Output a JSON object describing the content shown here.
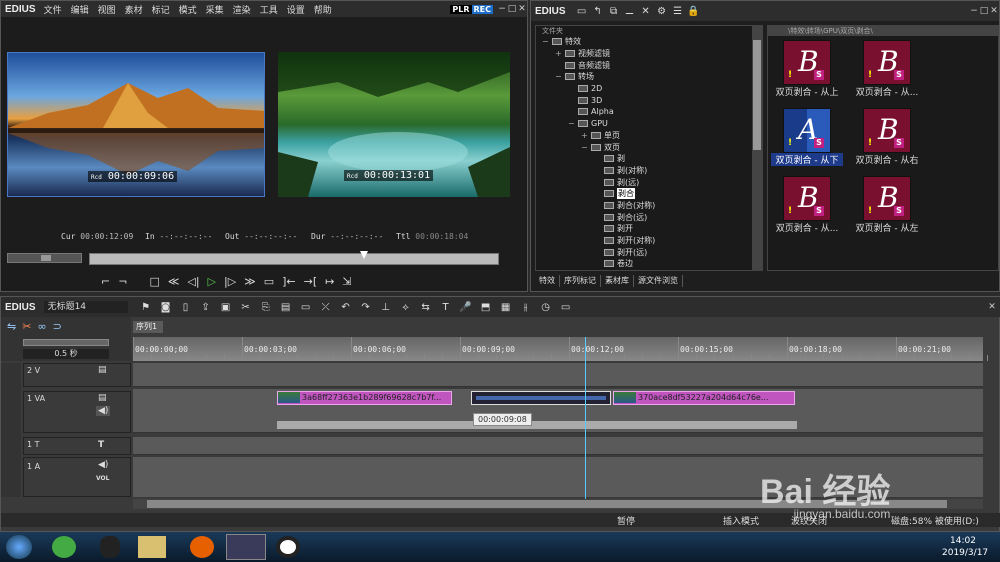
{
  "player": {
    "logo": "EDIUS",
    "menu": [
      "文件",
      "编辑",
      "视图",
      "素材",
      "标记",
      "模式",
      "采集",
      "渲染",
      "工具",
      "设置",
      "帮助"
    ],
    "plr": "PLR",
    "rec": "REC",
    "left_tc_label": "Rcd",
    "left_tc": "00:00:09:06",
    "right_tc_label": "Rcd",
    "right_tc": "00:00:13:01",
    "cur_label": "Cur",
    "cur_value": "00:00:12:09",
    "in_label": "In",
    "in_value": "--:--:--:--",
    "out_label": "Out",
    "out_value": "--:--:--:--",
    "dur_label": "Dur",
    "dur_value": "--:--:--:--",
    "ttl_label": "Ttl",
    "ttl_value": "00:00:18:04"
  },
  "library": {
    "logo": "EDIUS",
    "folder_header": "文件夹",
    "path": "\\特效\\转场\\GPU\\双页\\剥合\\",
    "tree": [
      {
        "label": "特效",
        "indent": 0,
        "exp": "−"
      },
      {
        "label": "视频滤镜",
        "indent": 1,
        "exp": "+"
      },
      {
        "label": "音频滤镜",
        "indent": 1,
        "exp": ""
      },
      {
        "label": "转场",
        "indent": 1,
        "exp": "−"
      },
      {
        "label": "2D",
        "indent": 2,
        "exp": ""
      },
      {
        "label": "3D",
        "indent": 2,
        "exp": ""
      },
      {
        "label": "Alpha",
        "indent": 2,
        "exp": ""
      },
      {
        "label": "GPU",
        "indent": 2,
        "exp": "−"
      },
      {
        "label": "单页",
        "indent": 3,
        "exp": "+"
      },
      {
        "label": "双页",
        "indent": 3,
        "exp": "−"
      },
      {
        "label": "剥",
        "indent": 4,
        "exp": ""
      },
      {
        "label": "剥(对称)",
        "indent": 4,
        "exp": ""
      },
      {
        "label": "剥(远)",
        "indent": 4,
        "exp": ""
      },
      {
        "label": "剥合",
        "indent": 4,
        "exp": "",
        "selected": true
      },
      {
        "label": "剥合(对称)",
        "indent": 4,
        "exp": ""
      },
      {
        "label": "剥合(远)",
        "indent": 4,
        "exp": ""
      },
      {
        "label": "剥开",
        "indent": 4,
        "exp": ""
      },
      {
        "label": "剥开(对称)",
        "indent": 4,
        "exp": ""
      },
      {
        "label": "剥开(远)",
        "indent": 4,
        "exp": ""
      },
      {
        "label": "卷边",
        "indent": 4,
        "exp": ""
      }
    ],
    "effects": [
      {
        "label": "双页剥合 - 从上",
        "selected": false
      },
      {
        "label": "双页剥合 - 从...",
        "selected": false
      },
      {
        "label": "双页剥合 - 从下",
        "selected": true
      },
      {
        "label": "双页剥合 - 从右",
        "selected": false
      },
      {
        "label": "双页剥合 - 从...",
        "selected": false
      },
      {
        "label": "双页剥合 - 从左",
        "selected": false
      }
    ],
    "tabs": [
      "特效",
      "序列标记",
      "素材库",
      "源文件浏览"
    ]
  },
  "timeline": {
    "logo": "EDIUS",
    "project_name": "无标题14",
    "sequence_tab": "序列1",
    "zoom": "0.5 秒",
    "ruler": [
      "00:00:00;00",
      "00:00:03;00",
      "00:00:06;00",
      "00:00:09;00",
      "00:00:12;00",
      "00:00:15;00",
      "00:00:18;00",
      "00:00:21;00"
    ],
    "tracks": [
      {
        "name": "2 V"
      },
      {
        "name": "1 VA"
      },
      {
        "name": "1 T"
      },
      {
        "name": "1 A"
      }
    ],
    "clip1": "3a68ff27363e1b289f69628c7b7f...",
    "clip2": "370ace8df53227a204d64c76e...",
    "tooltip": "00:00:09:08",
    "vol": "VOL",
    "t_icon": "T"
  },
  "statusbar": {
    "pause": "暂停",
    "insert_mode": "插入模式",
    "ripple": "波纹关闭",
    "disk": "磁盘:58% 被使用(D:)"
  },
  "taskbar": {
    "time": "14:02",
    "date": "2019/3/17"
  },
  "watermark": {
    "brand": "Bai 经验",
    "url": "jingyan.baidu.com"
  }
}
